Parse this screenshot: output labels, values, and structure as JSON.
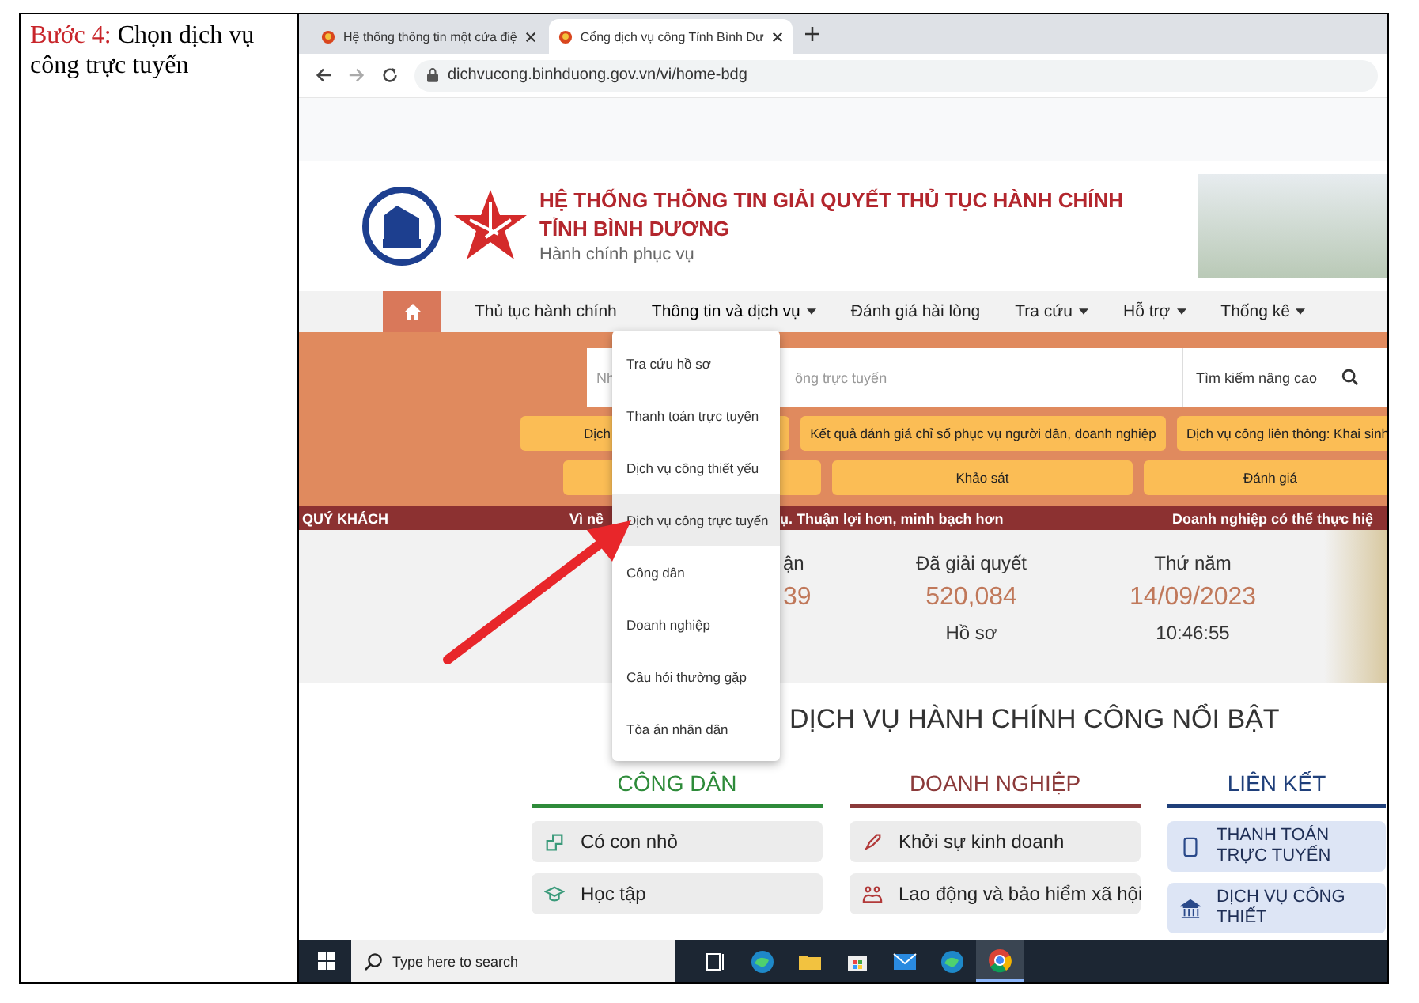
{
  "instruction": {
    "step": "Bước 4:",
    "text": "Chọn dịch vụ công trực tuyến"
  },
  "browser": {
    "tabs": [
      {
        "title": "Hệ thống thông tin một cửa điệ",
        "selected": false
      },
      {
        "title": "Cổng dịch vụ công Tỉnh Bình Dư",
        "selected": true
      }
    ],
    "url": "dichvucong.binhduong.gov.vn/vi/home-bdg"
  },
  "site": {
    "title_line1": "HỆ THỐNG THÔNG TIN GIẢI QUYẾT THỦ TỤC HÀNH CHÍNH",
    "title_line2": "TỈNH BÌNH DƯƠNG",
    "subtitle": "Hành chính phục vụ",
    "nav": [
      {
        "label": "Thủ tục hành chính",
        "dropdown": false,
        "selected": false
      },
      {
        "label": "Thông tin và dịch vụ",
        "dropdown": true,
        "selected": true
      },
      {
        "label": "Đánh giá hài lòng",
        "dropdown": false,
        "selected": false
      },
      {
        "label": "Tra cứu",
        "dropdown": true,
        "selected": false
      },
      {
        "label": "Hỗ trợ",
        "dropdown": true,
        "selected": false
      },
      {
        "label": "Thống kê",
        "dropdown": true,
        "selected": false
      }
    ],
    "menu": [
      {
        "label": "Tra cứu hồ sơ",
        "selected": false
      },
      {
        "label": "Thanh toán trực tuyến",
        "selected": false
      },
      {
        "label": "Dịch vụ công thiết yếu",
        "selected": false
      },
      {
        "label": "Dịch vụ công trực tuyến",
        "selected": true
      },
      {
        "label": "Công dân",
        "selected": false
      },
      {
        "label": "Doanh nghiệp",
        "selected": false
      },
      {
        "label": "Câu hỏi thường gặp",
        "selected": false
      },
      {
        "label": "Tòa án nhân dân",
        "selected": false
      }
    ],
    "search": {
      "left_part": "Nh",
      "right_part": "ông trực tuyến",
      "advanced": "Tìm kiếm nâng cao"
    },
    "quick_row1": [
      "Dịch",
      "Kết quả đánh giá chỉ số phục vụ người dân, doanh nghiệp",
      "Dịch vụ công liên thông: Khai sinh"
    ],
    "quick_row2": [
      "Khảo sát",
      "Đánh giá"
    ],
    "marquee": [
      "QUÝ KHÁCH",
      "Vì nề",
      "ụ. Thuận lợi hơn, minh bạch hơn",
      "Doanh nghiệp có thể thực hiệ"
    ],
    "stats": [
      {
        "label": "ận",
        "value": "39"
      },
      {
        "label": "Đã giải quyết",
        "value": "520,084",
        "unit": "Hồ sơ"
      },
      {
        "label": "Thứ năm",
        "value": "14/09/2023",
        "unit": "10:46:55"
      }
    ],
    "heading": "DỊCH VỤ HÀNH CHÍNH CÔNG NỔI BẬT",
    "columns": [
      {
        "title": "CÔNG DÂN",
        "color": "#2e8b3a",
        "kind": "service",
        "items": [
          "Có con nhỏ",
          "Học tập"
        ]
      },
      {
        "title": "DOANH NGHIỆP",
        "color": "#8b3a3a",
        "kind": "service",
        "items": [
          "Khởi sự kinh doanh",
          "Lao động và bảo hiểm xã hội"
        ]
      },
      {
        "title": "LIÊN KẾT",
        "color": "#1f3f7a",
        "kind": "link",
        "items": [
          "THANH TOÁN TRỰC TUYẾN",
          "DỊCH VỤ CÔNG THIẾT"
        ]
      }
    ]
  },
  "taskbar": {
    "search_placeholder": "Type here to search",
    "apps": [
      {
        "kind": "task-view",
        "selected": false
      },
      {
        "kind": "edge",
        "selected": false
      },
      {
        "kind": "folder",
        "selected": false
      },
      {
        "kind": "store",
        "selected": false
      },
      {
        "kind": "mail",
        "selected": false
      },
      {
        "kind": "edge",
        "selected": false
      },
      {
        "kind": "chrome",
        "selected": true
      }
    ]
  }
}
